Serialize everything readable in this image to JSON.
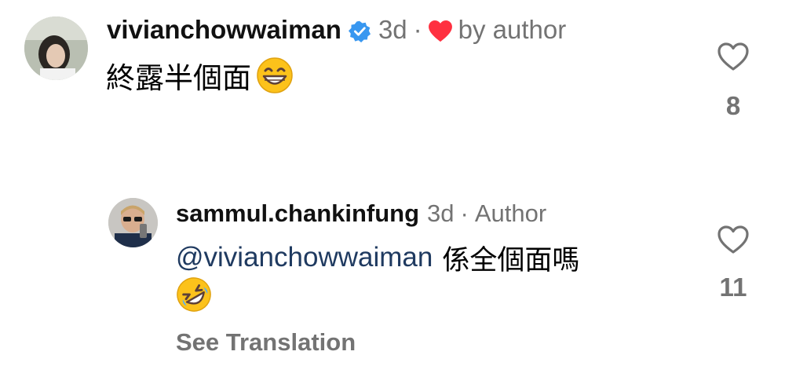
{
  "comment": {
    "username": "vivianchowwaiman",
    "time": "3d",
    "separator": "·",
    "liked_by_author": "by author",
    "text": "終露半個面",
    "emoji_icon": "grinning-face-with-smiling-eyes-emoji",
    "like_count": "8"
  },
  "reply": {
    "username": "sammul.chankinfung",
    "time": "3d",
    "separator": "·",
    "role": "Author",
    "mention": "@vivianchowwaiman",
    "text": "係全個面嗎",
    "emoji_icon": "rolling-on-floor-laughing-emoji",
    "like_count": "11",
    "see_translation": "See Translation"
  },
  "colors": {
    "meta_gray": "#737373",
    "verified_blue": "#3897f0",
    "heart_red": "#ff3040",
    "mention_blue": "#1f3a60"
  }
}
